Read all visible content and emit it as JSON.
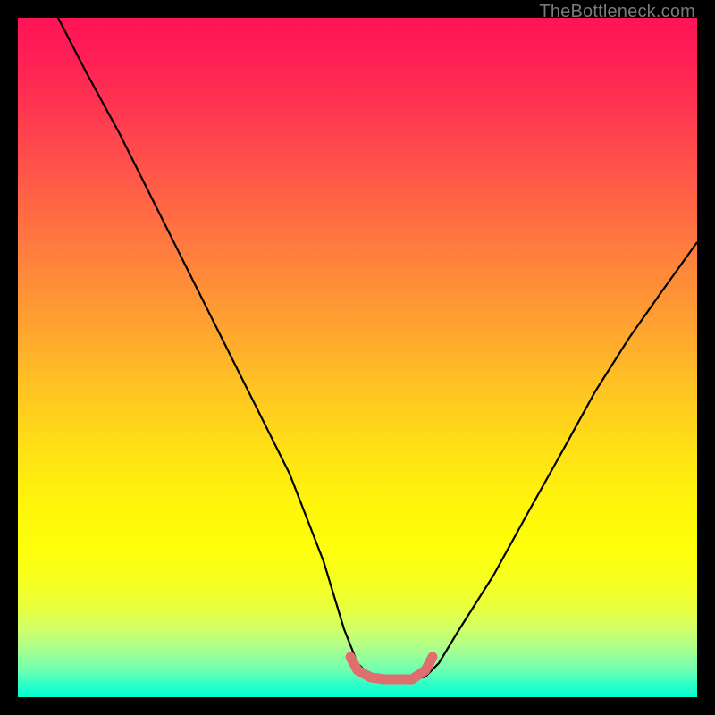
{
  "watermark": "TheBottleneck.com",
  "chart_data": {
    "type": "line",
    "title": "",
    "xlabel": "",
    "ylabel": "",
    "xlim": [
      0,
      100
    ],
    "ylim": [
      0,
      100
    ],
    "grid": false,
    "series": [
      {
        "name": "bottleneck-curve",
        "x": [
          6,
          10,
          15,
          20,
          25,
          30,
          35,
          40,
          45,
          48,
          50,
          52,
          54,
          56,
          58,
          60,
          62,
          65,
          70,
          75,
          80,
          85,
          90,
          95,
          100
        ],
        "y": [
          100,
          92,
          83,
          73,
          63,
          53,
          43,
          33,
          20,
          10,
          5,
          3,
          2.5,
          2.5,
          2.5,
          3,
          5,
          10,
          18,
          27,
          36,
          45,
          53,
          60,
          67
        ]
      },
      {
        "name": "highlight-band",
        "x": [
          49,
          50,
          52,
          54,
          56,
          58,
          60,
          61
        ],
        "y": [
          6,
          4,
          3,
          2.8,
          2.8,
          3,
          4,
          6
        ]
      }
    ],
    "highlight_color": "#e07070",
    "curve_color": "#000000"
  }
}
